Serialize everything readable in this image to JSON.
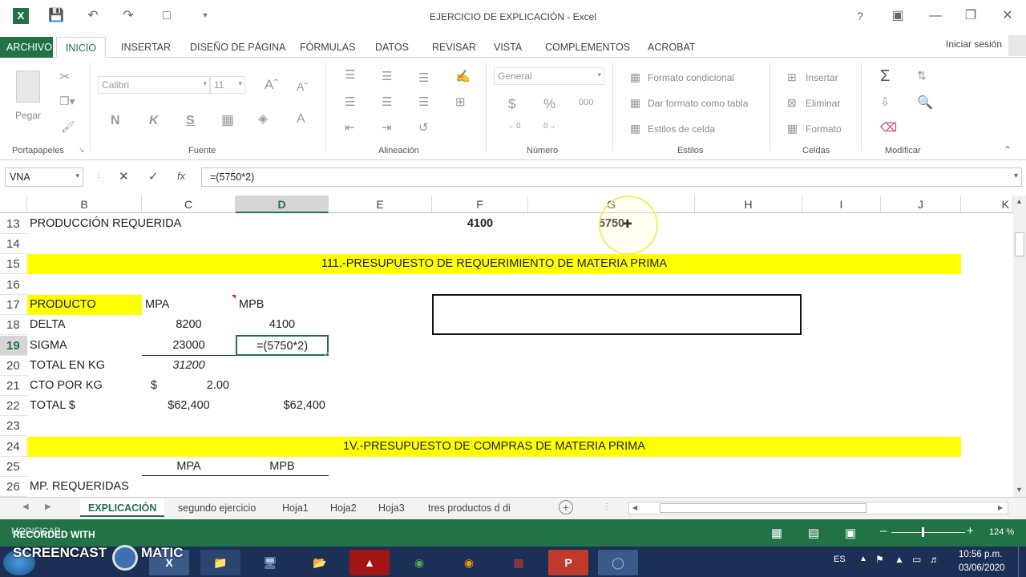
{
  "app": {
    "title": "EJERCICIO DE EXPLICACIÓN - Excel",
    "signin": "Iniciar sesión",
    "help": "?"
  },
  "tabs": [
    "ARCHIVO",
    "INICIO",
    "INSERTAR",
    "DISEÑO DE PÁGINA",
    "FÓRMULAS",
    "DATOS",
    "REVISAR",
    "VISTA",
    "COMPLEMENTOS",
    "ACROBAT"
  ],
  "ribbon": {
    "paste": "Pegar",
    "font_name": "Calibri",
    "font_size": "11",
    "bold": "N",
    "italic": "K",
    "underline": "S",
    "number_format": "General",
    "percent": "%",
    "thousands": "000",
    "currency": "$",
    "cond_format": "Formato condicional",
    "table_format": "Dar formato como tabla",
    "cell_styles": "Estilos de celda",
    "insert": "Insertar",
    "delete": "Eliminar",
    "format": "Formato",
    "groups": [
      "Portapapeles",
      "Fuente",
      "Alineación",
      "Número",
      "Estilos",
      "Celdas",
      "Modificar"
    ]
  },
  "formula_bar": {
    "name_box": "VNA",
    "formula": "=(5750*2)",
    "fx": "fx"
  },
  "columns": [
    "B",
    "C",
    "D",
    "E",
    "F",
    "G",
    "H",
    "I",
    "J",
    "K"
  ],
  "rows": [
    "13",
    "14",
    "15",
    "16",
    "17",
    "18",
    "19",
    "20",
    "21",
    "22",
    "23",
    "24",
    "25",
    "26"
  ],
  "cells": {
    "r13_b": "PRODUCCIÓN REQUERIDA",
    "r13_f": "4100",
    "r13_g": "5750",
    "r15_title": "111.-PRESUPUESTO DE REQUERIMIENTO DE MATERIA PRIMA",
    "r17_b": "PRODUCTO",
    "r17_c": "MPA",
    "r17_d": "MPB",
    "r18_b": "DELTA",
    "r18_c": "8200",
    "r18_d": "4100",
    "r19_b": "SIGMA",
    "r19_c": "23000",
    "r19_d": "=(5750*2)",
    "r20_b": "TOTAL EN KG",
    "r20_c": "31200",
    "r21_b": "CTO POR KG",
    "r21_c_sym": "$",
    "r21_c": "2.00",
    "r22_b": "TOTAL $",
    "r22_c": "$62,400",
    "r22_d": "$62,400",
    "r24_title": "1V.-PRESUPUESTO DE COMPRAS DE MATERIA PRIMA",
    "r25_c": "MPA",
    "r25_d": "MPB",
    "r26_b": "MP. REQUERIDAS"
  },
  "sheets": [
    "EXPLICACIÓN",
    "segundo ejercicio",
    "Hoja1",
    "Hoja2",
    "Hoja3",
    "tres productos d  di"
  ],
  "status": {
    "mode": "MODIFICAR",
    "zoom": "124 %",
    "recorded": "RECORDED WITH",
    "brand": "SCREENCAST",
    "brand2": "MATIC"
  },
  "taskbar": {
    "lang": "ES",
    "time": "10:56 p.m.",
    "date": "03/06/2020"
  },
  "colors": {
    "accent": "#217346",
    "highlight": "#ffff00",
    "taskbar": "#1c2f55"
  }
}
